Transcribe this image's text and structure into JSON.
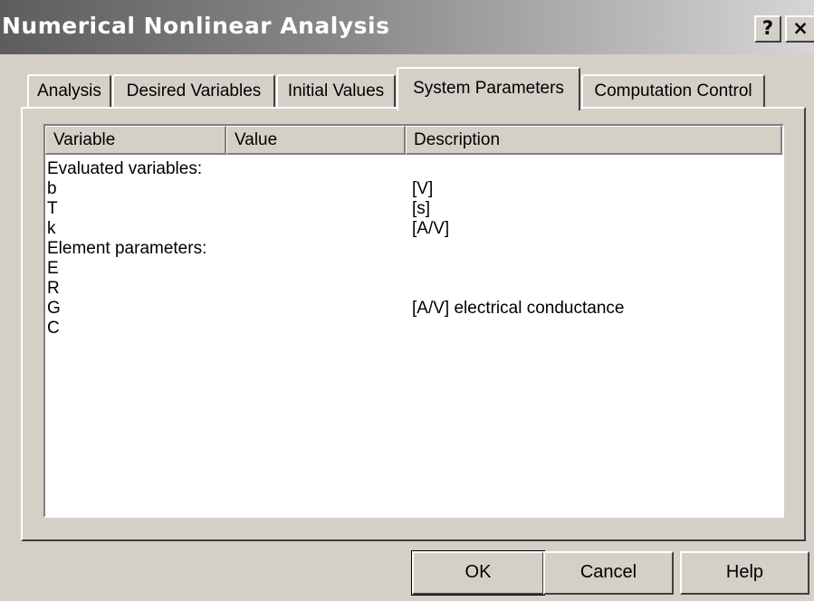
{
  "window": {
    "title": "Numerical Nonlinear Analysis",
    "help_glyph": "?",
    "close_glyph": "×"
  },
  "tabs": [
    {
      "label": "Analysis",
      "active": false
    },
    {
      "label": "Desired Variables",
      "active": false
    },
    {
      "label": "Initial Values",
      "active": false
    },
    {
      "label": "System Parameters",
      "active": true
    },
    {
      "label": "Computation Control",
      "active": false
    }
  ],
  "table": {
    "columns": [
      "Variable",
      "Value",
      "Description"
    ],
    "rows": [
      {
        "variable": "Evaluated variables:",
        "value": "",
        "description": ""
      },
      {
        "variable": "b",
        "value": "",
        "description": "[V]"
      },
      {
        "variable": "T",
        "value": "",
        "description": "[s]"
      },
      {
        "variable": "k",
        "value": "",
        "description": "[A/V]"
      },
      {
        "variable": "Element parameters:",
        "value": "",
        "description": ""
      },
      {
        "variable": "E",
        "value": "",
        "description": ""
      },
      {
        "variable": "R",
        "value": "",
        "description": ""
      },
      {
        "variable": "G",
        "value": "",
        "description": "[A/V] electrical conductance"
      },
      {
        "variable": "C",
        "value": "",
        "description": ""
      }
    ]
  },
  "buttons": {
    "ok": "OK",
    "cancel": "Cancel",
    "help": "Help"
  }
}
